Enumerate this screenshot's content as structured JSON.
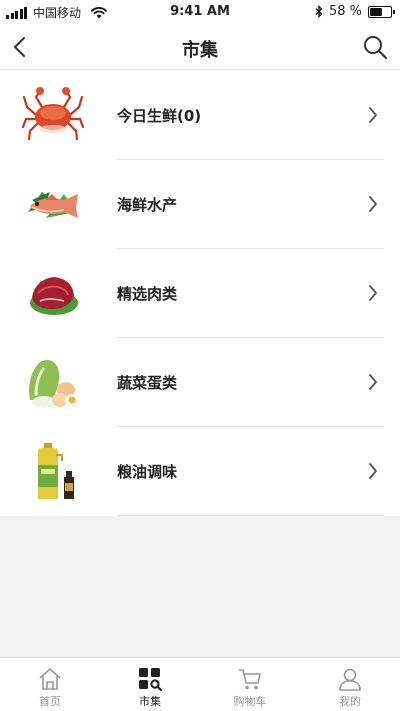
{
  "status_bar": {
    "carrier": "中国移动",
    "time": "9:41 AM",
    "battery_text": "58 %",
    "battery_level": 0.58
  },
  "nav": {
    "title": "市集",
    "back_icon": "chevron-left-icon",
    "search_icon": "search-icon"
  },
  "categories": [
    {
      "label": "今日生鲜(0)",
      "icon": "crab-image"
    },
    {
      "label": "海鲜水产",
      "icon": "fish-image"
    },
    {
      "label": "精选肉类",
      "icon": "meat-image"
    },
    {
      "label": "蔬菜蛋类",
      "icon": "vegetable-egg-image"
    },
    {
      "label": "粮油调味",
      "icon": "oil-bottle-image"
    }
  ],
  "tabbar": {
    "items": [
      {
        "label": "首页",
        "icon": "home-icon",
        "active": false
      },
      {
        "label": "市集",
        "icon": "market-grid-icon",
        "active": true
      },
      {
        "label": "购物车",
        "icon": "cart-icon",
        "active": false
      },
      {
        "label": "我的",
        "icon": "person-icon",
        "active": false
      }
    ]
  },
  "colors": {
    "background": "#f3f3f3",
    "crab": "#d9482b",
    "active_tab": "#222222",
    "inactive_tab": "#999999"
  }
}
